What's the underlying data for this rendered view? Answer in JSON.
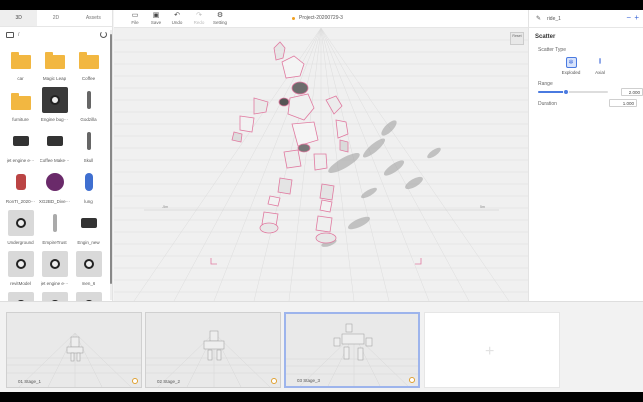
{
  "left_panel": {
    "tabs": [
      {
        "label": "3D",
        "active": true
      },
      {
        "label": "2D",
        "active": false
      },
      {
        "label": "Assets",
        "active": false
      }
    ],
    "path": "/",
    "assets": [
      {
        "label": "car",
        "kind": "folder"
      },
      {
        "label": "Magic Leap",
        "kind": "folder"
      },
      {
        "label": "Coffee",
        "kind": "folder"
      },
      {
        "label": "furniture",
        "kind": "folder"
      },
      {
        "label": "Engine bug···",
        "kind": "model"
      },
      {
        "label": "Godzilla",
        "kind": "model"
      },
      {
        "label": "jet engine e···",
        "kind": "model"
      },
      {
        "label": "Coffee Make···",
        "kind": "model"
      },
      {
        "label": "Skull",
        "kind": "model"
      },
      {
        "label": "RonTI_2020···",
        "kind": "model"
      },
      {
        "label": "XG2BD_Dive···",
        "kind": "model"
      },
      {
        "label": "lung",
        "kind": "model"
      },
      {
        "label": "Underground",
        "kind": "model"
      },
      {
        "label": "EmpireTrust",
        "kind": "model"
      },
      {
        "label": "Engin_new",
        "kind": "model"
      },
      {
        "label": "revitModel",
        "kind": "model"
      },
      {
        "label": "jet engine e···",
        "kind": "model"
      },
      {
        "label": "men_6",
        "kind": "model"
      }
    ]
  },
  "toolbar": {
    "tools": [
      {
        "label": "File",
        "icon": "folder-icon"
      },
      {
        "label": "Save",
        "icon": "save-icon"
      },
      {
        "label": "Undo",
        "icon": "undo-icon"
      },
      {
        "label": "Redo",
        "icon": "redo-icon"
      },
      {
        "label": "Setting",
        "icon": "gear-icon"
      }
    ],
    "project_name": "Project-20200729-3"
  },
  "viewport": {
    "reset_label": "Reset",
    "axis_left": "-5m",
    "axis_right": "5m"
  },
  "right_panel": {
    "name": "ride_1",
    "section_title": "Scatter",
    "scatter_type_label": "Scatter Type",
    "options": [
      {
        "label": "Exploded",
        "selected": true
      },
      {
        "label": "Axial",
        "selected": false
      }
    ],
    "range_label": "Range",
    "range_value": "2.000",
    "range_fraction": 0.4,
    "duration_label": "Duration",
    "duration_value": "1.000"
  },
  "stages": [
    {
      "label": "01  Stage_1",
      "active": false
    },
    {
      "label": "02  Stage_2",
      "active": false
    },
    {
      "label": "03  Stage_3",
      "active": true
    }
  ],
  "colors": {
    "accent": "#3a66d8",
    "folder": "#f2b741",
    "robot_outline": "#e07aa0"
  }
}
